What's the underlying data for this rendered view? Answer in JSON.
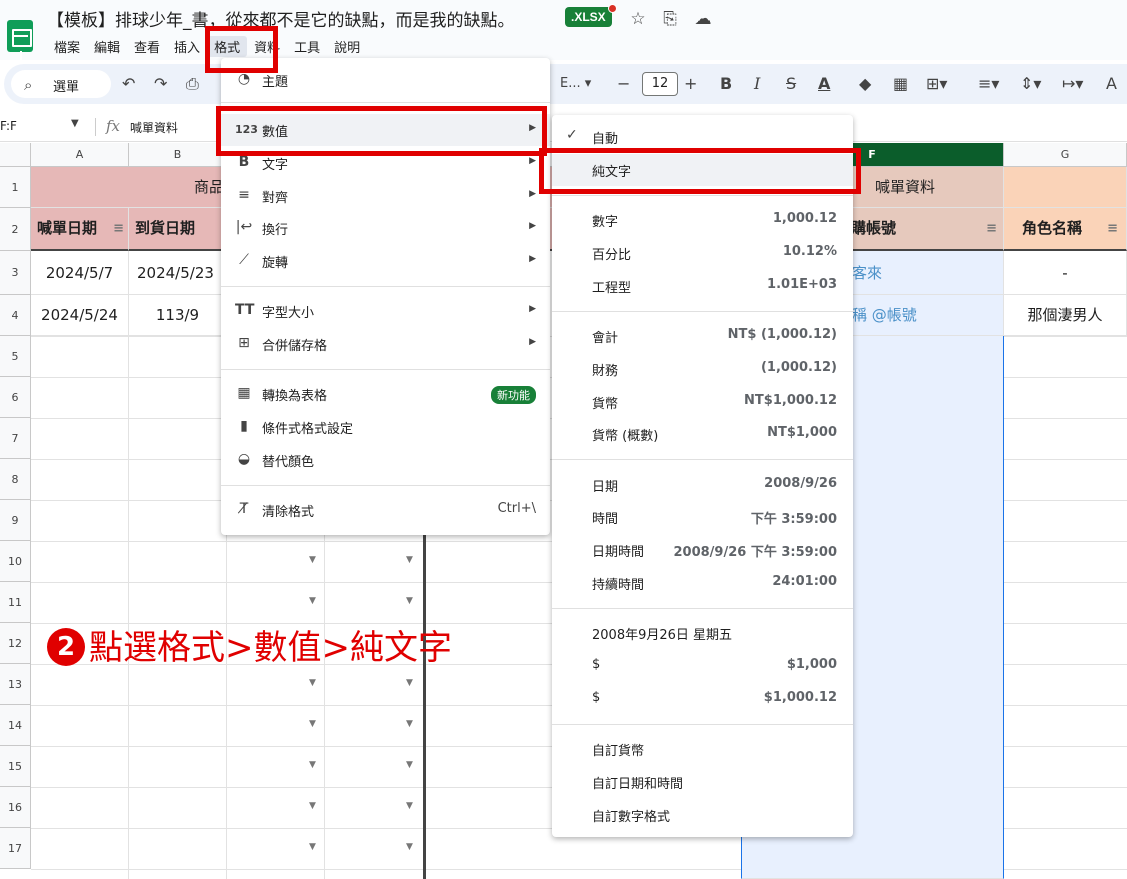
{
  "title_bar": {
    "doc_title": "【模板】排球少年_書，從來都不是它的缺點，而是我的缺點。",
    "file_badge": ".XLSX",
    "star_icon": "star-icon",
    "move_icon": "folder-move-icon",
    "cloud_icon": "cloud-status-icon"
  },
  "menu": [
    "檔案",
    "編輯",
    "查看",
    "插入",
    "格式",
    "資料",
    "工具",
    "說明"
  ],
  "toolbar": {
    "search_label": "選單",
    "font_size": "12"
  },
  "formula_bar": {
    "name_box": "F:F",
    "fx": "fx",
    "content": "喊單資料"
  },
  "columns": [
    "A",
    "B",
    "",
    "",
    "",
    "F",
    "G"
  ],
  "rows": [
    "1",
    "2",
    "3",
    "4",
    "5",
    "6",
    "7",
    "8",
    "9",
    "10",
    "11",
    "12",
    "13",
    "14",
    "15",
    "16",
    "17"
  ],
  "cells": {
    "row1_b": "商品",
    "row1_f": "喊單資料",
    "row2_a": "喊單日期",
    "row2_b": "到貨日期",
    "row2_f": "購帳號",
    "row2_g": "角色名稱",
    "row3_a": "2024/5/7",
    "row3_b": "2024/5/23",
    "row3_f": "轉客來",
    "row3_g": "-",
    "row4_a": "2024/5/24",
    "row4_b": "113/9",
    "row4_f": "名稱 @帳號",
    "row4_g": "那個淒男人"
  },
  "format_menu": {
    "theme": "主題",
    "number": "數值",
    "text": "文字",
    "align": "對齊",
    "wrap": "換行",
    "rotate": "旋轉",
    "font_size": "字型大小",
    "merge": "合併儲存格",
    "convert_table": "轉換為表格",
    "new_badge": "新功能",
    "conditional": "條件式格式設定",
    "alternating": "替代顏色",
    "clear": "清除格式",
    "clear_shortcut": "Ctrl+\\"
  },
  "number_menu": {
    "auto": "自動",
    "plain_text": "純文字",
    "number": "數字",
    "number_ex": "1,000.12",
    "percent": "百分比",
    "percent_ex": "10.12%",
    "scientific": "工程型",
    "scientific_ex": "1.01E+03",
    "accounting": "會計",
    "accounting_ex": "NT$ (1,000.12)",
    "financial": "財務",
    "financial_ex": "(1,000.12)",
    "currency": "貨幣",
    "currency_ex": "NT$1,000.12",
    "currency_round": "貨幣 (概數)",
    "currency_round_ex": "NT$1,000",
    "date": "日期",
    "date_ex": "2008/9/26",
    "time": "時間",
    "time_ex": "下午 3:59:00",
    "datetime": "日期時間",
    "datetime_ex": "2008/9/26 下午 3:59:00",
    "duration": "持續時間",
    "duration_ex": "24:01:00",
    "long_date": "2008年9月26日 星期五",
    "dollar1": "$",
    "dollar1_ex": "$1,000",
    "dollar2": "$",
    "dollar2_ex": "$1,000.12",
    "custom_currency": "自訂貨幣",
    "custom_datetime": "自訂日期和時間",
    "custom_number": "自訂數字格式"
  },
  "annotation": {
    "step": "2",
    "text": "點選格式>數值>純文字"
  }
}
